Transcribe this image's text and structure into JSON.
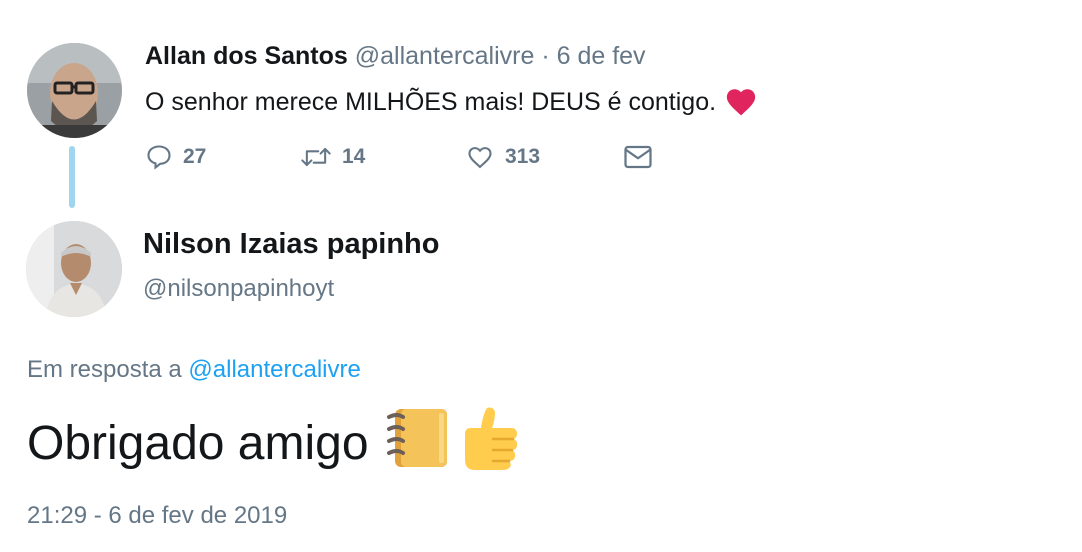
{
  "tweet1": {
    "author_name": "Allan dos Santos",
    "handle": "@allantercalivre",
    "separator": " · ",
    "date": "6 de fev",
    "text": "O senhor merece MILHÕES mais! DEUS é contigo.",
    "emoji_icon": "red-heart-icon",
    "replies": "27",
    "retweets": "14",
    "likes": "313"
  },
  "tweet2": {
    "author_name": "Nilson Izaias papinho",
    "handle": "@nilsonpapinhoyt",
    "reply_prefix": "Em resposta a",
    "reply_handle": "@allantercalivre",
    "text": "Obrigado amigo",
    "emoji_icons": [
      "notebook-icon",
      "thumbs-up-icon"
    ],
    "timestamp": "21:29 - 6 de fev de 2019"
  },
  "colors": {
    "text": "#14171a",
    "secondary": "#657786",
    "link": "#1da1f2",
    "thread_line": "#9fd5ef",
    "heart": "#e0245e"
  }
}
